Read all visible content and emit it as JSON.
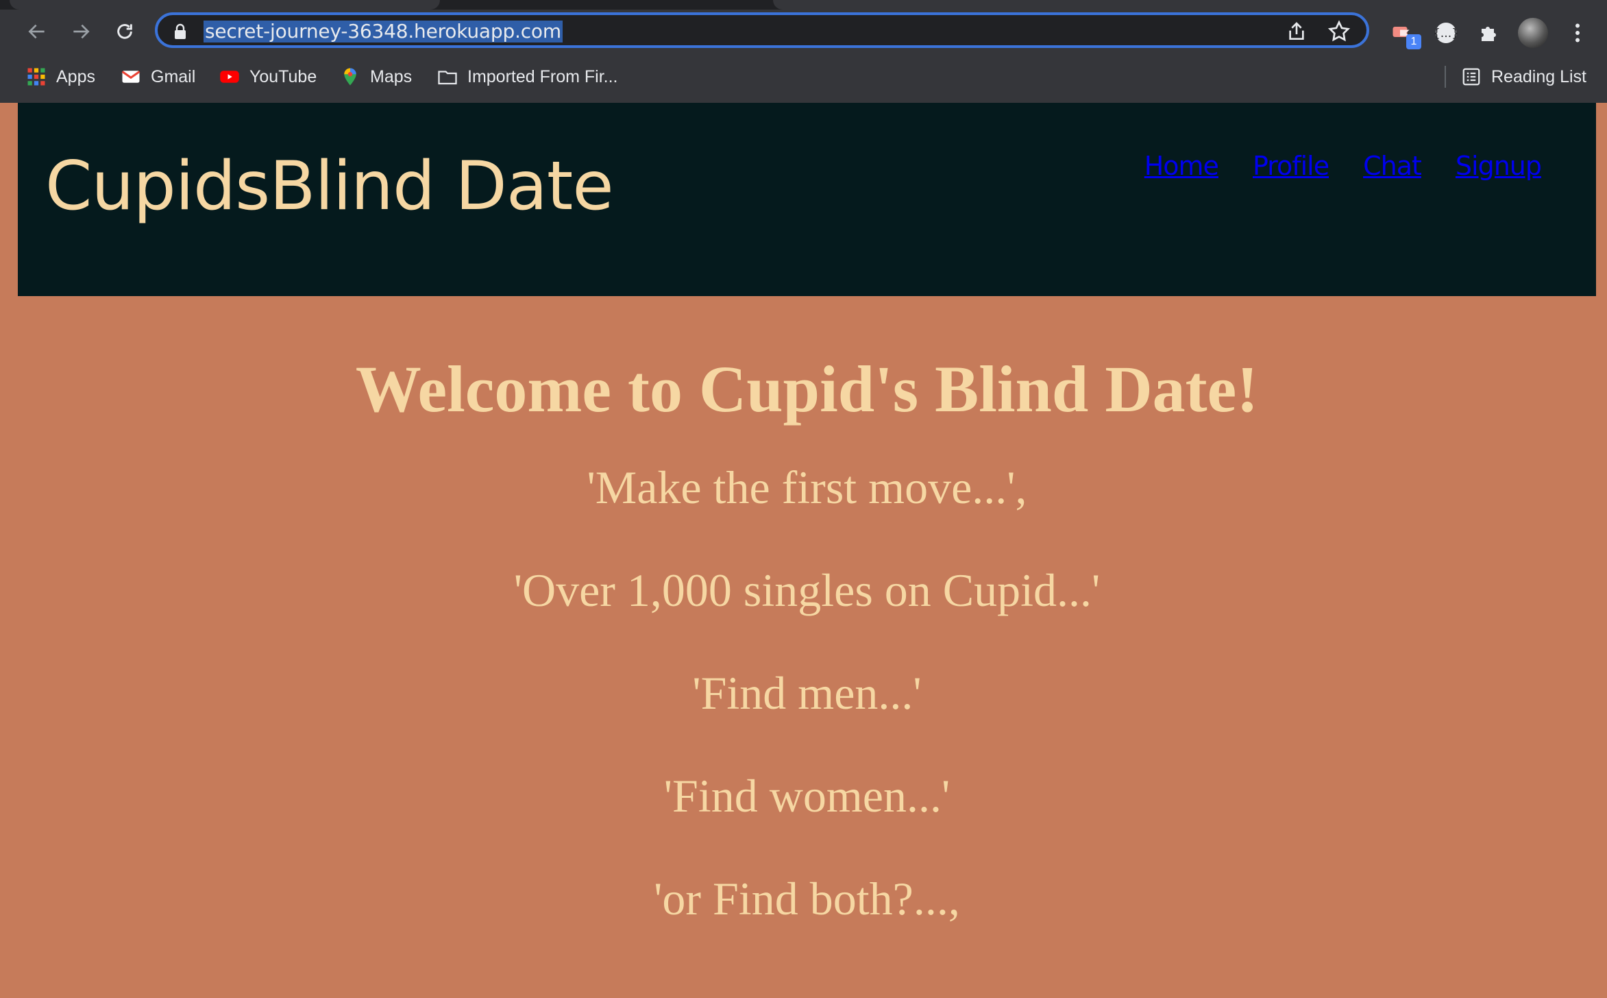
{
  "browser": {
    "url": "secret-journey-36348.herokuapp.com",
    "extension_badge": "1",
    "bookmarks": [
      {
        "label": "Apps",
        "icon": "apps-grid-icon"
      },
      {
        "label": "Gmail",
        "icon": "gmail-icon"
      },
      {
        "label": "YouTube",
        "icon": "youtube-icon"
      },
      {
        "label": "Maps",
        "icon": "maps-pin-icon"
      },
      {
        "label": "Imported From Fir...",
        "icon": "folder-icon"
      }
    ],
    "reading_list": "Reading List"
  },
  "site": {
    "title": "CupidsBlind Date",
    "nav": [
      "Home",
      "Profile",
      "Chat",
      "Signup"
    ]
  },
  "main": {
    "welcome": "Welcome to Cupid's Blind Date!",
    "taglines": [
      "'Make the first move...',",
      "'Over 1,000 singles on Cupid...'",
      "'Find men...'",
      "'Find women...'",
      "'or Find both?...,"
    ]
  },
  "colors": {
    "page_bg": "#c67b5a",
    "header_bg": "#051a1d",
    "accent_text": "#f6d7a3",
    "link": "#0000ee",
    "omnibox_focus": "#3b73d9"
  }
}
